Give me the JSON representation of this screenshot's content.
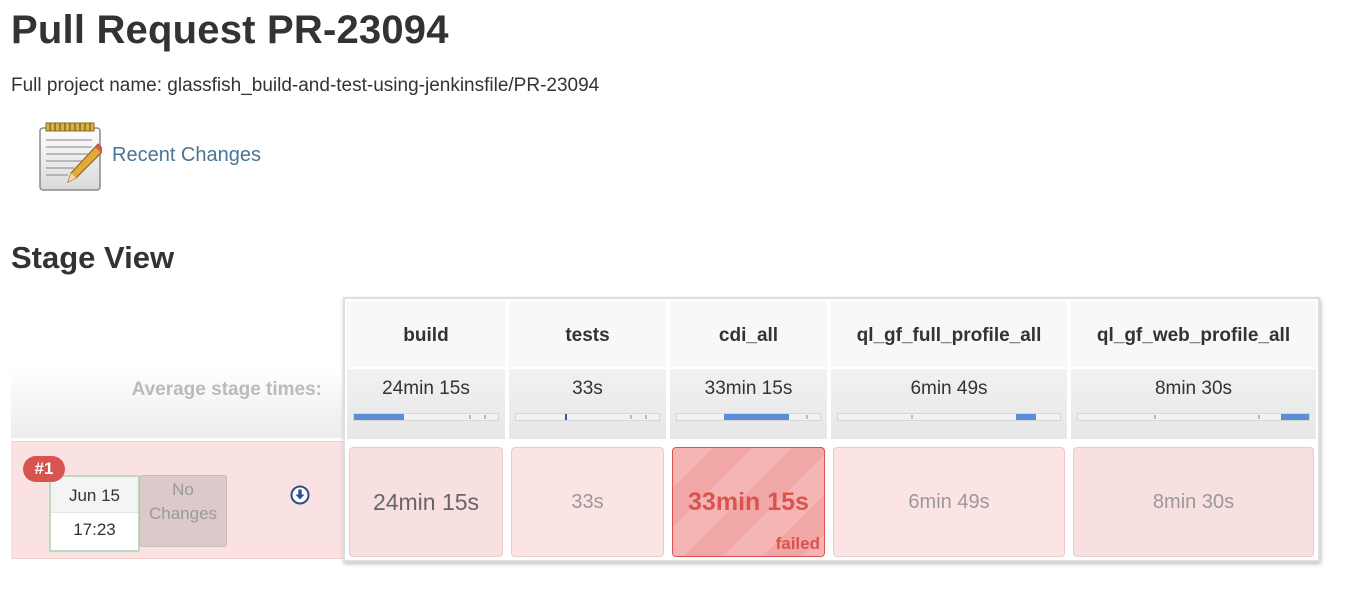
{
  "page": {
    "title": "Pull Request PR-23094",
    "full_name_label": "Full project name: glassfish_build-and-test-using-jenkinsfile/PR-23094"
  },
  "links": {
    "recent_changes": "Recent Changes"
  },
  "stage_view": {
    "title": "Stage View",
    "avg_label": "Average stage times:",
    "stages": [
      {
        "name": "build",
        "avg": "24min 15s",
        "avg_bar_fraction": 0.35,
        "cell": "24min 15s",
        "status": "success"
      },
      {
        "name": "tests",
        "avg": "33s",
        "avg_bar_fraction": 0.01,
        "cell": "33s",
        "status": "success"
      },
      {
        "name": "cdi_all",
        "avg": "33min 15s",
        "avg_bar_fraction": 0.45,
        "cell": "33min 15s",
        "status": "failed"
      },
      {
        "name": "ql_gf_full_profile_all",
        "avg": "6min 49s",
        "avg_bar_fraction": 0.1,
        "cell": "6min 49s",
        "status": "success"
      },
      {
        "name": "ql_gf_web_profile_all",
        "avg": "8min 30s",
        "avg_bar_fraction": 0.12,
        "cell": "8min 30s",
        "status": "success"
      }
    ],
    "build": {
      "number": "#1",
      "date": "Jun 15",
      "time": "17:23",
      "changes": "No Changes",
      "failed_label": "failed"
    }
  },
  "colors": {
    "failed": "#d9534f",
    "link": "#4a7594",
    "progress": "#5b8dd9",
    "row_background": "#fbe2e2"
  },
  "icons": [
    "notepad-icon",
    "download-icon"
  ]
}
